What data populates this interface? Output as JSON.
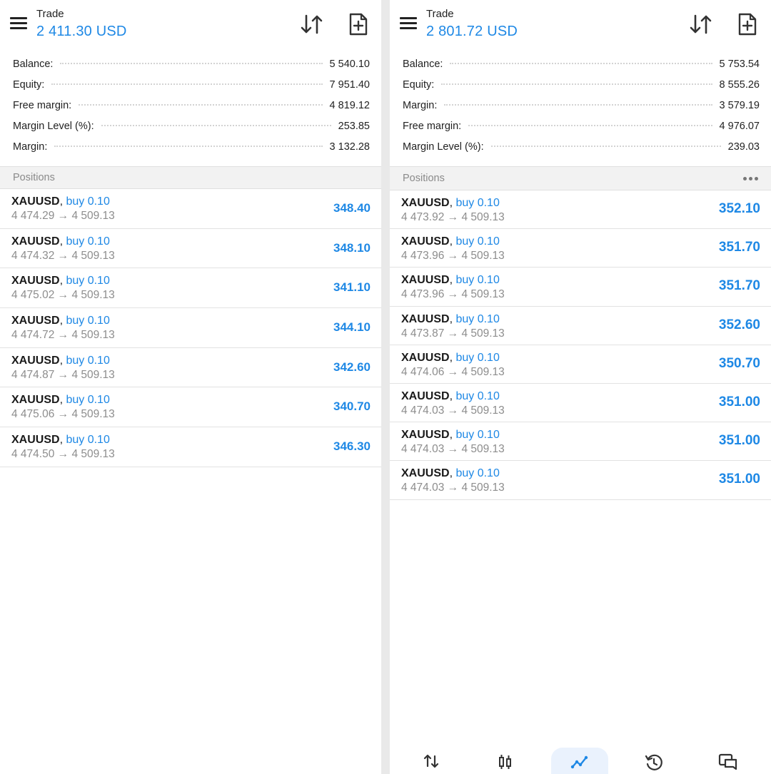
{
  "colors": {
    "accent": "#1e88e5",
    "muted": "#8d8d8d",
    "text": "#1a1a1a"
  },
  "left": {
    "header": {
      "title": "Trade",
      "amount": "2 411.30 USD"
    },
    "stats": [
      {
        "label": "Balance:",
        "value": "5 540.10"
      },
      {
        "label": "Equity:",
        "value": "7 951.40"
      },
      {
        "label": "Free margin:",
        "value": "4 819.12"
      },
      {
        "label": "Margin Level (%):",
        "value": "253.85"
      },
      {
        "label": "Margin:",
        "value": "3 132.28"
      }
    ],
    "positions_title": "Positions",
    "positions": [
      {
        "symbol": "XAUUSD",
        "sep": ",",
        "side": "buy 0.10",
        "prices": "4 474.29 → 4 509.13",
        "profit": "348.40"
      },
      {
        "symbol": "XAUUSD",
        "sep": ",",
        "side": "buy 0.10",
        "prices": "4 474.32 → 4 509.13",
        "profit": "348.10"
      },
      {
        "symbol": "XAUUSD",
        "sep": ",",
        "side": "buy 0.10",
        "prices": "4 475.02 → 4 509.13",
        "profit": "341.10"
      },
      {
        "symbol": "XAUUSD",
        "sep": ",",
        "side": "buy 0.10",
        "prices": "4 474.72 → 4 509.13",
        "profit": "344.10"
      },
      {
        "symbol": "XAUUSD",
        "sep": ",",
        "side": "buy 0.10",
        "prices": "4 474.87 → 4 509.13",
        "profit": "342.60"
      },
      {
        "symbol": "XAUUSD",
        "sep": ",",
        "side": "buy 0.10",
        "prices": "4 475.06 → 4 509.13",
        "profit": "340.70"
      },
      {
        "symbol": "XAUUSD",
        "sep": ",",
        "side": "buy 0.10",
        "prices": "4 474.50 → 4 509.13",
        "profit": "346.30"
      }
    ]
  },
  "right": {
    "header": {
      "title": "Trade",
      "amount": "2 801.72 USD"
    },
    "stats": [
      {
        "label": "Balance:",
        "value": "5 753.54"
      },
      {
        "label": "Equity:",
        "value": "8 555.26"
      },
      {
        "label": "Margin:",
        "value": "3 579.19"
      },
      {
        "label": "Free margin:",
        "value": "4 976.07"
      },
      {
        "label": "Margin Level (%):",
        "value": "239.03"
      }
    ],
    "positions_title": "Positions",
    "positions": [
      {
        "symbol": "XAUUSD",
        "sep": ",",
        "side": "buy 0.10",
        "prices": "4 473.92 → 4 509.13",
        "profit": "352.10"
      },
      {
        "symbol": "XAUUSD",
        "sep": ",",
        "side": "buy 0.10",
        "prices": "4 473.96 → 4 509.13",
        "profit": "351.70"
      },
      {
        "symbol": "XAUUSD",
        "sep": ",",
        "side": "buy 0.10",
        "prices": "4 473.96 → 4 509.13",
        "profit": "351.70"
      },
      {
        "symbol": "XAUUSD",
        "sep": ",",
        "side": "buy 0.10",
        "prices": "4 473.87 → 4 509.13",
        "profit": "352.60"
      },
      {
        "symbol": "XAUUSD",
        "sep": ",",
        "side": "buy 0.10",
        "prices": "4 474.06 → 4 509.13",
        "profit": "350.70"
      },
      {
        "symbol": "XAUUSD",
        "sep": ",",
        "side": "buy 0.10",
        "prices": "4 474.03 → 4 509.13",
        "profit": "351.00"
      },
      {
        "symbol": "XAUUSD",
        "sep": ",",
        "side": "buy 0.10",
        "prices": "4 474.03 → 4 509.13",
        "profit": "351.00"
      },
      {
        "symbol": "XAUUSD",
        "sep": ",",
        "side": "buy 0.10",
        "prices": "4 474.03 → 4 509.13",
        "profit": "351.00"
      }
    ],
    "bottom_nav": [
      {
        "name": "quotes-icon",
        "active": false
      },
      {
        "name": "chart-icon",
        "active": false
      },
      {
        "name": "trade-icon",
        "active": true
      },
      {
        "name": "history-icon",
        "active": false
      },
      {
        "name": "messages-icon",
        "active": false
      }
    ]
  }
}
